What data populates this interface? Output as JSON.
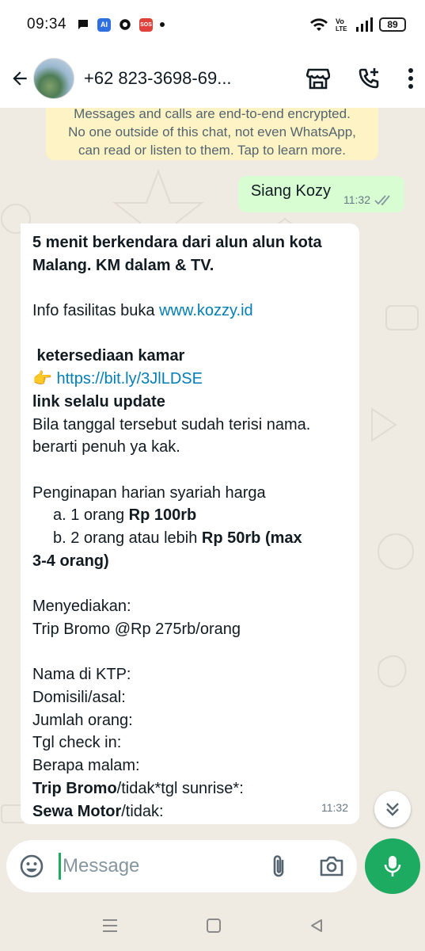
{
  "status_bar": {
    "time": "09:34",
    "battery": "89",
    "ai_badge": "AI",
    "sos_badge": "SOS"
  },
  "header": {
    "contact": "+62 823-3698-69...",
    "icons": [
      "back-arrow-icon",
      "avatar",
      "shop-icon",
      "add-call-icon",
      "more-vert-icon"
    ]
  },
  "encryption_notice": {
    "line1": "Messages and calls are end-to-end encrypted.",
    "line2": "No one outside of this chat, not even WhatsApp,",
    "line3": "can read or listen to them. Tap to learn more."
  },
  "outgoing": {
    "text": "Siang Kozy",
    "time": "11:32"
  },
  "incoming": {
    "time": "11:32",
    "line01": "5 menit berkendara dari alun alun kota",
    "line02": "Malang. KM dalam & TV.",
    "line03_pre": "Info fasilitas buka ",
    "line03_link": "www.kozzy.id",
    "line04": " ketersediaan kamar",
    "line05_emoji": "👉",
    "line05_link": "https://bit.ly/3JlLDSE",
    "line06": "link selalu update",
    "line07": "Bila tanggal tersebut sudah terisi nama.",
    "line08": "berarti penuh ya kak.",
    "line09": "Penginapan harian syariah harga",
    "line10_pre": "a. 1 orang ",
    "line10_bold": "Rp 100rb",
    "line11_pre": "b. 2 orang atau lebih ",
    "line11_bold": "Rp 50rb (max",
    "line12": "3-4 orang)",
    "line13": "Menyediakan:",
    "line14": "Trip Bromo @Rp 275rb/orang",
    "line15": "Nama di KTP:",
    "line16": "Domisili/asal:",
    "line17": "Jumlah orang:",
    "line18": "Tgl check in:",
    "line19": "Berapa malam:",
    "line20_bold": "Trip Bromo",
    "line20_rest": "/tidak*tgl sunrise*:",
    "line21_bold": "Sewa Motor",
    "line21_rest": "/tidak:"
  },
  "composer": {
    "placeholder": "Message"
  },
  "colors": {
    "accent": "#1daa61",
    "chat_bg": "#efeae2",
    "outgoing_bubble": "#d9fdd3",
    "notice_bg": "#fdf3c5",
    "link": "#027eb5"
  }
}
